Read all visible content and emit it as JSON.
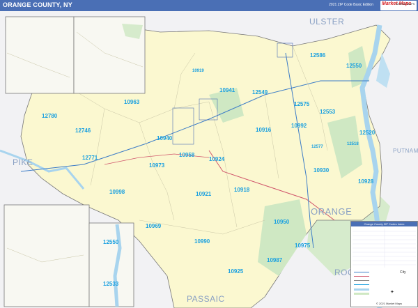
{
  "header": {
    "title": "ORANGE COUNTY, NY",
    "subtitle": "2021 ZIP Code Basic Edition",
    "logo_text": "Market Maps",
    "logo_sub": "WORLD MAPS"
  },
  "colors": {
    "title_bar": "#4a6fb5",
    "county_fill": "#fbf8d0",
    "outside_fill": "#f2f2f4",
    "water": "#bfe0f2",
    "park": "#cfe8c3",
    "zip_label": "#1aa0e0",
    "county_label": "#8aa1c4"
  },
  "neighbors": [
    {
      "name": "ULSTER"
    },
    {
      "name": "PIKE"
    },
    {
      "name": "PUTNAM"
    },
    {
      "name": "ORANGE"
    },
    {
      "name": "PASSAIC"
    },
    {
      "name": "ROC"
    }
  ],
  "zip_codes": [
    "12586",
    "12550",
    "12549",
    "10941",
    "12575",
    "12553",
    "12520",
    "10919",
    "10963",
    "12780",
    "12746",
    "12771",
    "10940",
    "10916",
    "10992",
    "12577",
    "12518",
    "10958",
    "10973",
    "10924",
    "10930",
    "10998",
    "10921",
    "10918",
    "10928",
    "10969",
    "10950",
    "10990",
    "10975",
    "10987",
    "10925",
    "12550",
    "12533"
  ],
  "legend": {
    "title": "Orange County ZIP Codes Index",
    "city_label": "City"
  },
  "copyright": "© 2021 Market Maps"
}
